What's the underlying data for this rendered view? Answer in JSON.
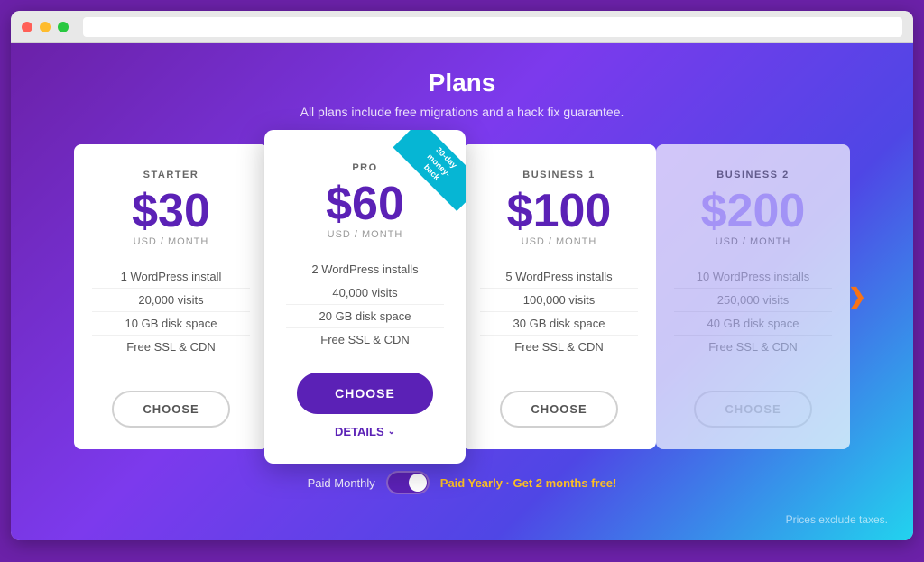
{
  "browser": {
    "dots": [
      "red",
      "yellow",
      "green"
    ]
  },
  "page": {
    "title": "Plans",
    "subtitle": "All plans include free migrations and a hack fix guarantee.",
    "tax_note": "Prices exclude taxes."
  },
  "billing": {
    "monthly_label": "Paid Monthly",
    "yearly_label": "Paid Yearly",
    "yearly_promo": "· Get 2 months free!",
    "toggle_state": "on"
  },
  "plans": [
    {
      "id": "starter",
      "name": "STARTER",
      "price": "$30",
      "period": "USD / MONTH",
      "features": [
        "1 WordPress install",
        "20,000 visits",
        "10 GB disk space",
        "Free SSL & CDN"
      ],
      "cta": "CHOOSE",
      "featured": false,
      "faded": false
    },
    {
      "id": "pro",
      "name": "PRO",
      "price": "$60",
      "period": "USD / MONTH",
      "features": [
        "2 WordPress installs",
        "40,000 visits",
        "20 GB disk space",
        "Free SSL & CDN"
      ],
      "cta": "CHOOSE",
      "featured": true,
      "ribbon": "30-day\nmoney-back",
      "details_label": "DETAILS",
      "faded": false
    },
    {
      "id": "business1",
      "name": "BUSINESS 1",
      "price": "$100",
      "period": "USD / MONTH",
      "features": [
        "5 WordPress installs",
        "100,000 visits",
        "30 GB disk space",
        "Free SSL & CDN"
      ],
      "cta": "CHOOSE",
      "featured": false,
      "faded": false
    },
    {
      "id": "business2",
      "name": "BUSINESS 2",
      "price": "$200",
      "period": "USD / MONTH",
      "features": [
        "10 WordPress installs",
        "250,000 visits",
        "40 GB disk space",
        "Free SSL & CDN"
      ],
      "cta": "CHOOSE",
      "featured": false,
      "faded": true
    }
  ],
  "icons": {
    "chevron_right": "❯",
    "chevron_down": "∨"
  }
}
